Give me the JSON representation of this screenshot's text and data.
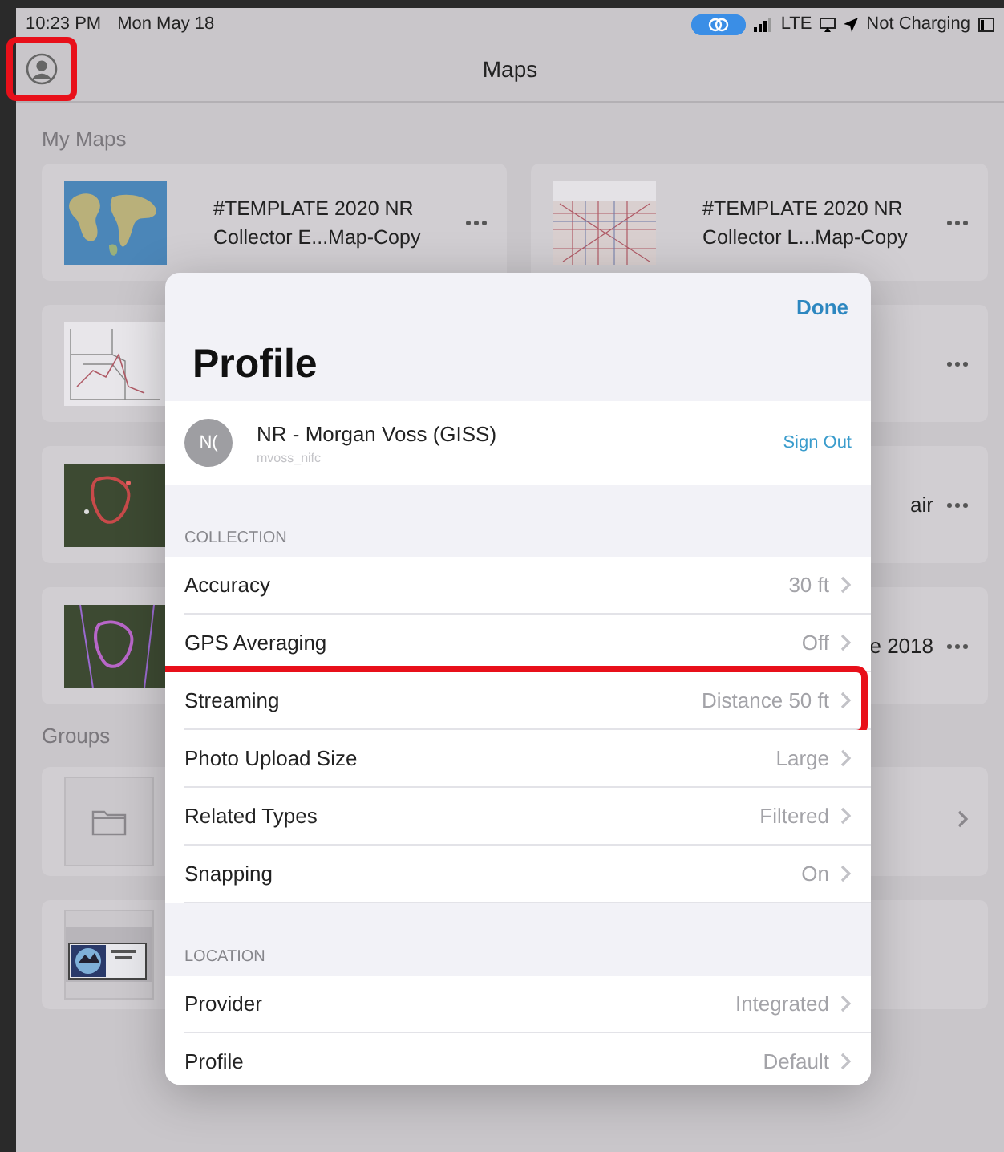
{
  "status_bar": {
    "time": "10:23 PM",
    "date": "Mon May 18",
    "network": "LTE",
    "charging": "Not Charging"
  },
  "nav": {
    "title": "Maps",
    "profile_button": {
      "highlighted": true
    }
  },
  "my_maps": {
    "label": "My Maps",
    "maps": [
      {
        "title": "#TEMPLATE 2020 NR Collector E...Map-Copy",
        "kind": "world"
      },
      {
        "title": "#TEMPLATE 2020 NR Collector L...Map-Copy",
        "kind": "roads"
      },
      {
        "kind": "outline"
      },
      {
        "kind": "hidden"
      },
      {
        "kind": "satellite"
      },
      {
        "title_fragment": "air",
        "kind": "hidden"
      },
      {
        "kind": "satellite_purple"
      },
      {
        "title_fragment": "e 2018",
        "kind": "hidden"
      }
    ]
  },
  "groups": {
    "label": "Groups",
    "items": [
      {
        "kind": "folder",
        "chevron": true
      },
      {
        "kind": "logo",
        "chevron": false
      }
    ]
  },
  "profile_sheet": {
    "done": "Done",
    "title": "Profile",
    "account": {
      "initials": "N(",
      "name": "NR - Morgan Voss (GISS)",
      "username": "mvoss_nifc",
      "sign_out": "Sign Out"
    },
    "sections": [
      {
        "header": "COLLECTION",
        "rows": [
          {
            "label": "Accuracy",
            "value": "30 ft",
            "highlighted": false
          },
          {
            "label": "GPS Averaging",
            "value": "Off",
            "highlighted": false
          },
          {
            "label": "Streaming",
            "value": "Distance 50 ft",
            "highlighted": true
          },
          {
            "label": "Photo Upload Size",
            "value": "Large",
            "highlighted": false
          },
          {
            "label": "Related Types",
            "value": "Filtered",
            "highlighted": false
          },
          {
            "label": "Snapping",
            "value": "On",
            "highlighted": false
          }
        ]
      },
      {
        "header": "LOCATION",
        "rows": [
          {
            "label": "Provider",
            "value": "Integrated",
            "highlighted": false
          },
          {
            "label": "Profile",
            "value": "Default",
            "highlighted": false
          }
        ]
      }
    ]
  }
}
